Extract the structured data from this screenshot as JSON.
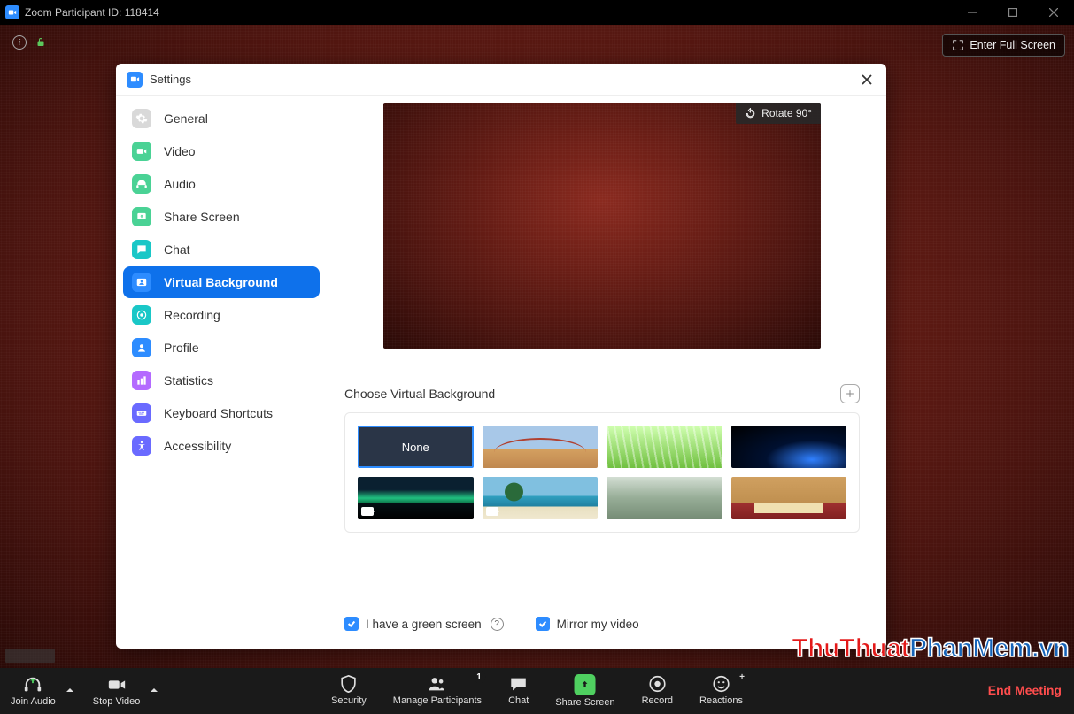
{
  "window": {
    "title": "Zoom Participant ID: 118414"
  },
  "meeting": {
    "fullscreen_label": "Enter Full Screen",
    "watermark_1": "ThuThuat",
    "watermark_2": "PhanMem",
    "watermark_3": ".vn"
  },
  "settings": {
    "title": "Settings",
    "sidebar": [
      {
        "key": "general",
        "label": "General"
      },
      {
        "key": "video",
        "label": "Video"
      },
      {
        "key": "audio",
        "label": "Audio"
      },
      {
        "key": "share",
        "label": "Share Screen"
      },
      {
        "key": "chat",
        "label": "Chat"
      },
      {
        "key": "vbg",
        "label": "Virtual Background"
      },
      {
        "key": "recording",
        "label": "Recording"
      },
      {
        "key": "profile",
        "label": "Profile"
      },
      {
        "key": "stats",
        "label": "Statistics"
      },
      {
        "key": "kbd",
        "label": "Keyboard Shortcuts"
      },
      {
        "key": "access",
        "label": "Accessibility"
      }
    ],
    "rotate_label": "Rotate 90°",
    "choose_label": "Choose Virtual Background",
    "none_label": "None",
    "check_green": "I have a green screen",
    "check_mirror": "Mirror my video"
  },
  "toolbar": {
    "join_audio": "Join Audio",
    "stop_video": "Stop Video",
    "security": "Security",
    "manage": "Manage Participants",
    "participants_count": "1",
    "chat": "Chat",
    "share": "Share Screen",
    "record": "Record",
    "reactions": "Reactions",
    "end": "End Meeting"
  }
}
